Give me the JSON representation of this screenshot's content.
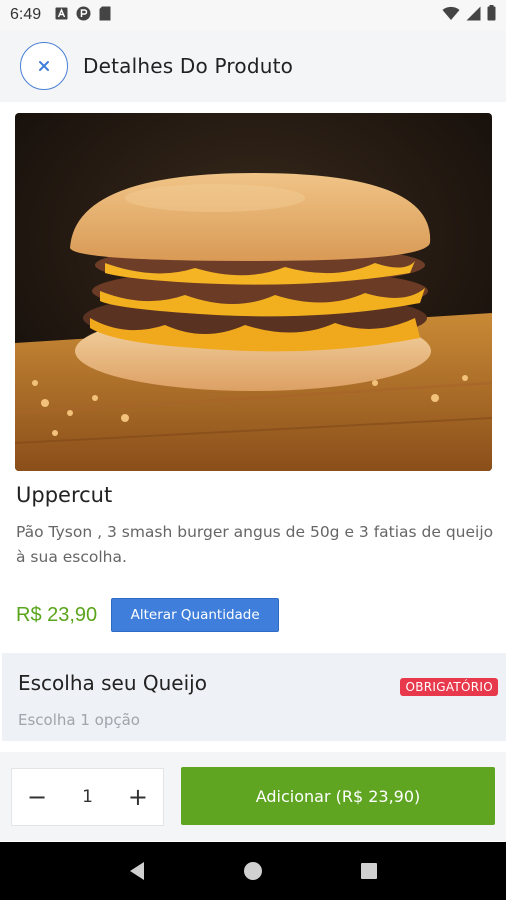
{
  "status_bar": {
    "time": "6:49",
    "icons": [
      "a-icon",
      "p-icon",
      "sd-card-icon"
    ],
    "right_icons": [
      "wifi-icon",
      "signal-icon",
      "battery-icon"
    ]
  },
  "header": {
    "title": "Detalhes Do Produto",
    "close_icon": "close-icon"
  },
  "product": {
    "image": "cheeseburger-photo",
    "name": "Uppercut",
    "description": "Pão Tyson , 3 smash burger angus de 50g e 3 fatias de queijo à sua escolha.",
    "price": "R$ 23,90",
    "change_qty_label": "Alterar Quantidade"
  },
  "options": {
    "title": "Escolha seu Queijo",
    "subtitle": "Escolha 1 opção",
    "badge": "OBRIGATÓRIO"
  },
  "cart": {
    "minus": "−",
    "quantity": "1",
    "plus": "+",
    "add_label": "Adicionar (R$ 23,90)"
  },
  "colors": {
    "accent_green": "#5fa522",
    "accent_blue": "#3f7fdb",
    "badge_red": "#e8394c"
  }
}
